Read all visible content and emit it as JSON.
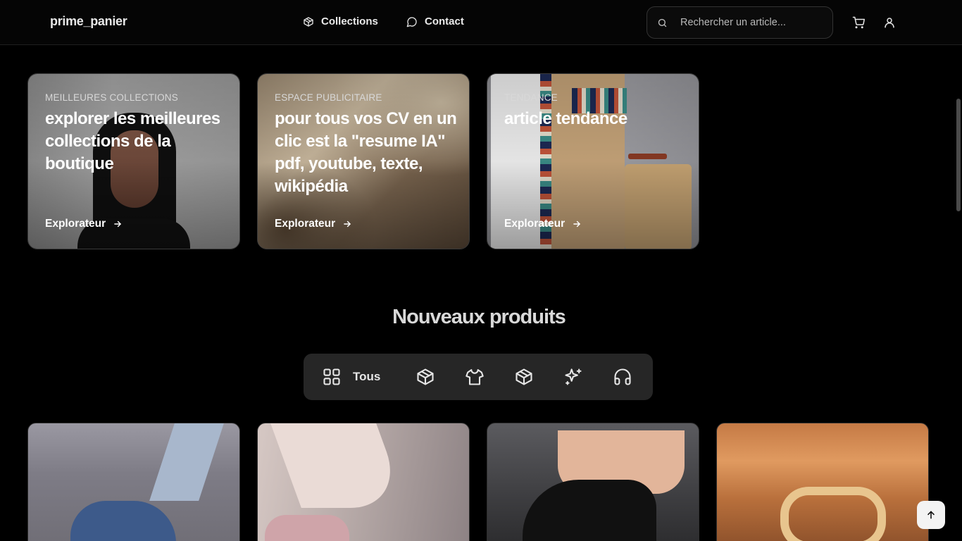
{
  "header": {
    "logo": "prime_panier",
    "nav": [
      {
        "label": "Collections",
        "icon": "box-icon"
      },
      {
        "label": "Contact",
        "icon": "chat-bubble-icon"
      }
    ],
    "search": {
      "placeholder": "Rechercher un article..."
    },
    "icons": [
      "cart-icon",
      "user-icon"
    ]
  },
  "promos": [
    {
      "eyebrow": "MEILLEURES COLLECTIONS",
      "headline": "explorer les meilleures collections de la boutique",
      "cta": "Explorateur"
    },
    {
      "eyebrow": "ESPACE PUBLICITAIRE",
      "headline": "pour tous vos CV en un clic est la \"resume IA\" pdf, youtube, texte, wikipédia",
      "cta": "Explorateur"
    },
    {
      "eyebrow": "TENDANCE",
      "headline": "article tendance",
      "cta": "Explorateur"
    }
  ],
  "new_products": {
    "title": "Nouveaux produits",
    "filters": [
      {
        "label": "Tous",
        "icon": "grid-icon"
      },
      {
        "icon": "box-icon"
      },
      {
        "icon": "shirt-icon"
      },
      {
        "icon": "box-icon"
      },
      {
        "icon": "sparkles-icon"
      },
      {
        "icon": "headphones-icon"
      }
    ]
  },
  "colors": {
    "background": "#000000",
    "filter_bar": "#262626",
    "text": "#ffffff"
  }
}
